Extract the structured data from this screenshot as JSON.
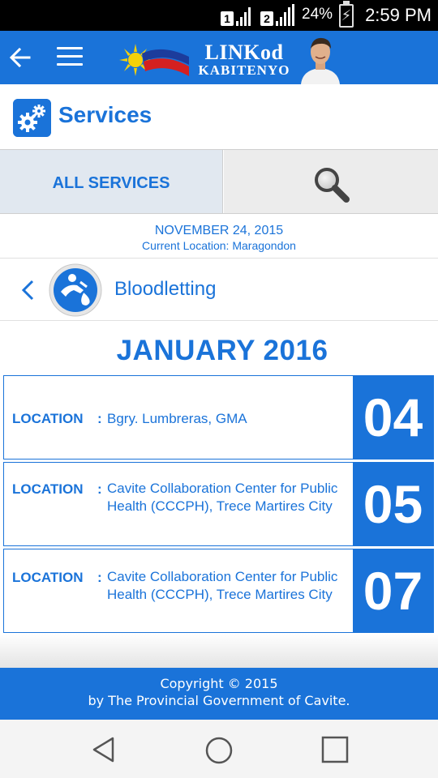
{
  "status_bar": {
    "sim1": "1",
    "sim2": "2",
    "battery": "24%",
    "time": "2:59 PM"
  },
  "app_bar": {
    "logo_line1": "LINKod",
    "logo_line2": "KABITENYO"
  },
  "services": {
    "title": "Services"
  },
  "tabs": {
    "all_services": "ALL SERVICES"
  },
  "date_info": {
    "date": "NOVEMBER 24, 2015",
    "location": "Current Location: Maragondon"
  },
  "category": {
    "name": "Bloodletting"
  },
  "schedule": {
    "month": "JANUARY 2016",
    "items": [
      {
        "label": "LOCATION",
        "colon": ":",
        "address": "Bgry. Lumbreras, GMA",
        "day": "04"
      },
      {
        "label": "LOCATION",
        "colon": ":",
        "address": "Cavite Collaboration Center for Public Health (CCCPH), Trece Martires City",
        "day": "05"
      },
      {
        "label": "LOCATION",
        "colon": ":",
        "address": "Cavite Collaboration Center for Public Health (CCCPH), Trece Martires City",
        "day": "07"
      }
    ]
  },
  "footer": {
    "line1": "Copyright © 2015",
    "line2": "by The Provincial Government of Cavite."
  },
  "colors": {
    "primary": "#1a73d9",
    "tab_active_bg": "#e1e8f0",
    "tab_inactive_bg": "#ececec"
  },
  "icons": [
    "back-arrow-icon",
    "menu-icon",
    "gears-icon",
    "search-icon",
    "chevron-left-icon",
    "bloodletting-icon",
    "nav-back-icon",
    "nav-home-icon",
    "nav-recents-icon"
  ]
}
